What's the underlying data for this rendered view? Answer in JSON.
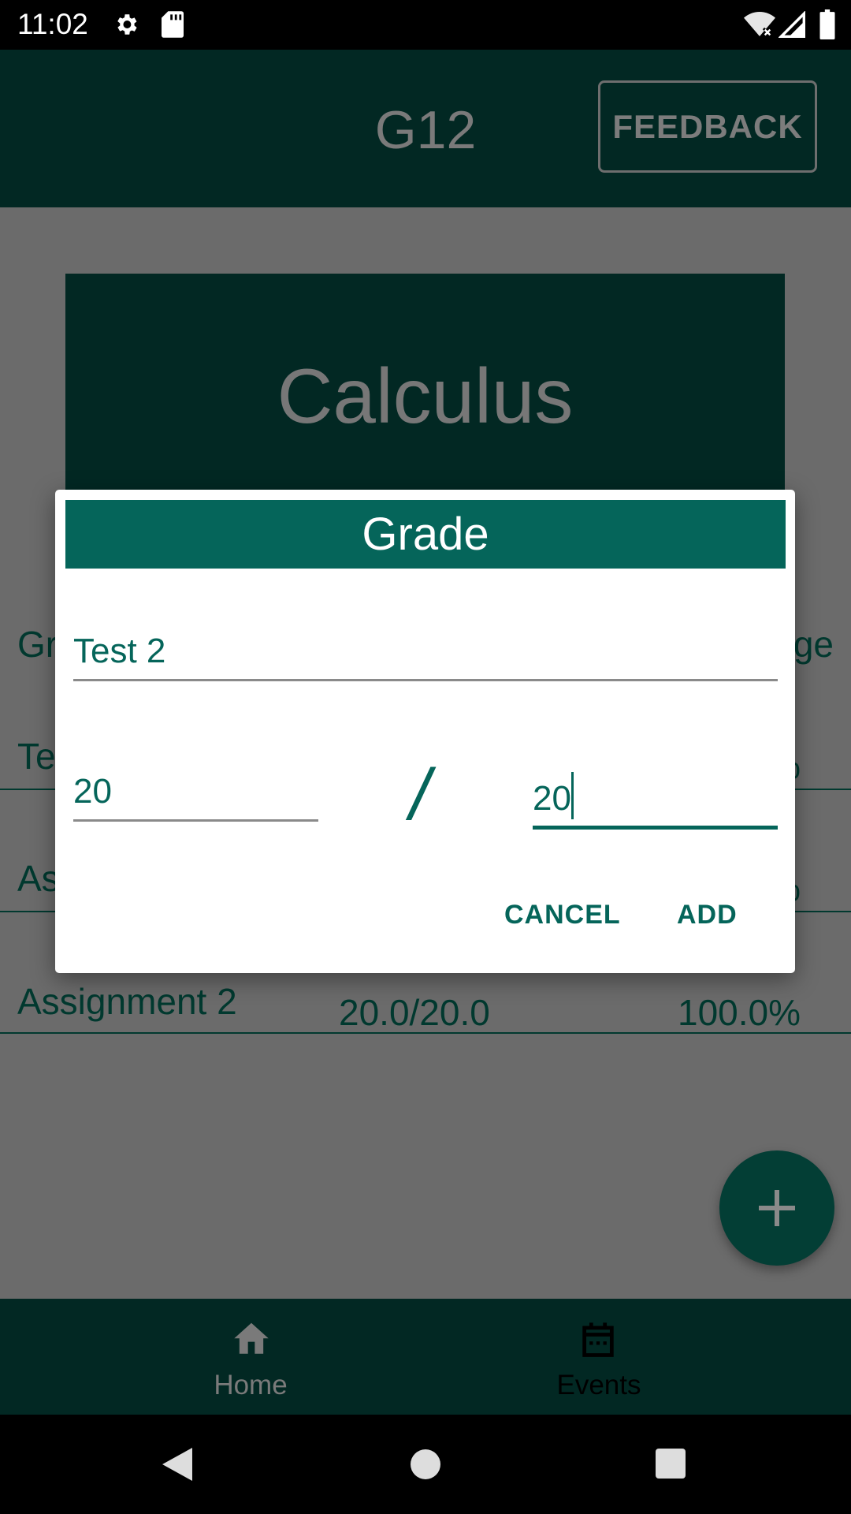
{
  "status_bar": {
    "time": "11:02",
    "icons": [
      "gear-icon",
      "sd-card-icon",
      "wifi-off-icon",
      "signal-icon",
      "battery-icon"
    ]
  },
  "app_bar": {
    "title": "G12",
    "feedback_label": "FEEDBACK"
  },
  "course": {
    "title": "Calculus"
  },
  "table": {
    "header": {
      "name": "Grade",
      "percent": "Percentage"
    },
    "rows": [
      {
        "name": "Test 1",
        "score": "",
        "percent": "%"
      },
      {
        "name": "Assignment 1",
        "score": "",
        "percent": "%"
      },
      {
        "name": "Assignment 2",
        "score": "20.0/20.0",
        "percent": "100.0%"
      }
    ]
  },
  "dialog": {
    "title": "Grade",
    "name_value": "Test 2",
    "score_value": "20",
    "separator": "/",
    "total_value": "20",
    "cancel_label": "CANCEL",
    "add_label": "ADD"
  },
  "bottom_nav": {
    "items": [
      {
        "label": "Home",
        "icon": "home-icon"
      },
      {
        "label": "Events",
        "icon": "calendar-icon"
      }
    ]
  },
  "colors": {
    "primary": "#05655a",
    "primary_dark": "#022823",
    "scrim_bg": "#6b6b6b"
  }
}
